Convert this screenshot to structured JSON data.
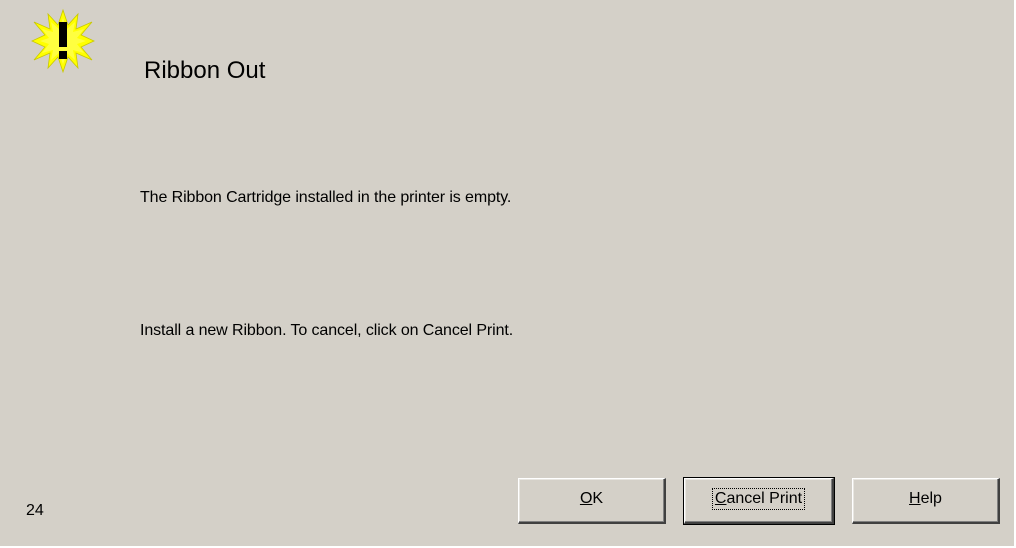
{
  "dialog": {
    "icon": "warning-exclamation-burst-icon",
    "title": "Ribbon Out",
    "message_1": "The Ribbon Cartridge installed in the printer is empty.",
    "message_2": "Install a new Ribbon. To cancel, click on Cancel Print.",
    "error_code": "24"
  },
  "buttons": {
    "ok": {
      "mnemonic": "O",
      "rest": "K"
    },
    "cancel_print": {
      "mnemonic": "C",
      "rest": "ancel Print"
    },
    "help": {
      "mnemonic": "H",
      "rest": "elp"
    }
  },
  "colors": {
    "dialog_background": "#d4d0c8",
    "icon_fill": "#ffff00",
    "text": "#000000"
  }
}
